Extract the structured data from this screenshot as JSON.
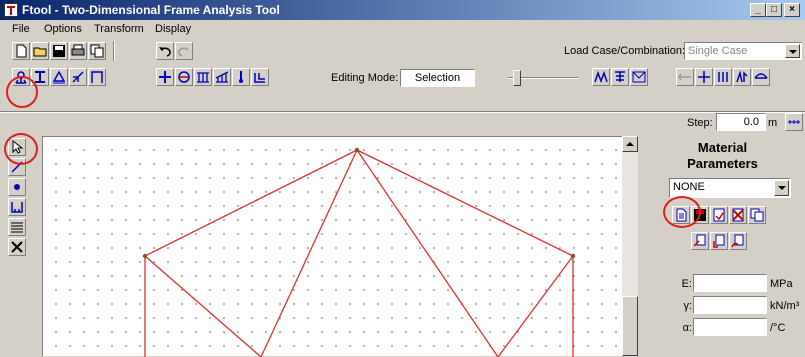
{
  "window": {
    "title": "Ftool - Two-Dimensional Frame Analysis Tool",
    "min": "_",
    "max": "□",
    "close": "×"
  },
  "menu": [
    "File",
    "Options",
    "Transform",
    "Display"
  ],
  "toolbar": {
    "load_case_label": "Load Case/Combination:",
    "load_case_value": "Single Case",
    "editing_mode_label": "Editing Mode:",
    "editing_mode_value": "Selection",
    "step_label": "Step:",
    "step_value": "0.0",
    "step_unit": "m"
  },
  "material_panel": {
    "title_line1": "Material",
    "title_line2": "Parameters",
    "selected": "NONE",
    "fields": [
      {
        "label": "E:",
        "unit": "MPa",
        "value": ""
      },
      {
        "label": "γ:",
        "unit": "kN/m³",
        "value": ""
      },
      {
        "label": "α:",
        "unit": "/°C",
        "value": ""
      }
    ]
  },
  "colors": {
    "accent_ring": "#e02020",
    "frame_line": "#e03030",
    "node": "#7a5a20"
  }
}
